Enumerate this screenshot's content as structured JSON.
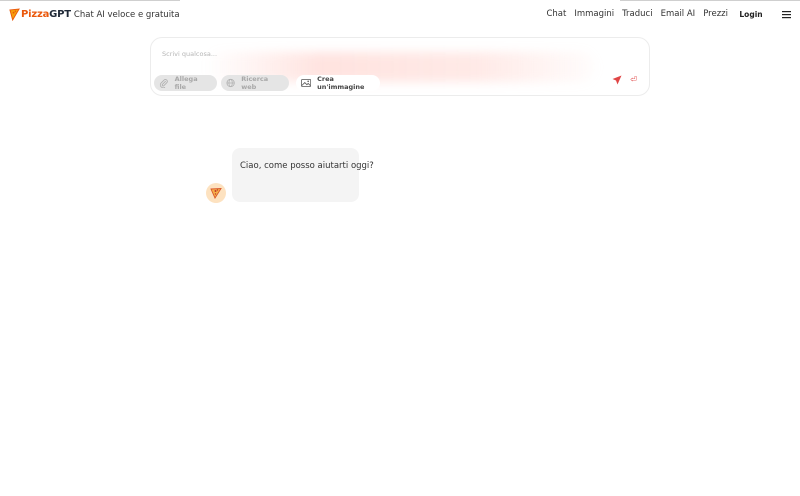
{
  "header": {
    "brand": {
      "name_prefix": "Pizza",
      "name_suffix": "GPT",
      "tagline": "Chat AI veloce e gratuita",
      "logo_icon": "pizza-slice-icon"
    },
    "nav": [
      "Chat",
      "Immagini",
      "Traduci",
      "Email AI",
      "Prezzi"
    ],
    "login_label": "Login",
    "menu_icon": "hamburger-menu-icon"
  },
  "composer": {
    "placeholder": "Scrivi qualcosa...",
    "value": "",
    "attach_label": "Allega file",
    "web_search_label": "Ricerca web",
    "create_image_label": "Crea un'immagine",
    "send_icon": "paper-plane-icon",
    "enter_icon": "enter-return-icon"
  },
  "chat": {
    "messages": [
      {
        "role": "assistant",
        "text": "Ciao, come posso aiutarti oggi?",
        "avatar": "pizza-slice-icon"
      }
    ]
  },
  "colors": {
    "brand": "#ea580c",
    "send": "#e04545",
    "bubble": "#f4f4f4",
    "chip_disabled": "#e5e5e5"
  }
}
